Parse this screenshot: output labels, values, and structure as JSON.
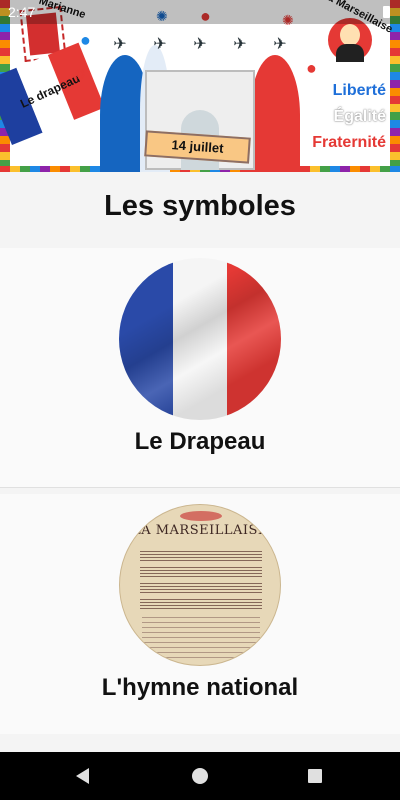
{
  "status_bar": {
    "time": "2:47"
  },
  "banner": {
    "marianne_label": "Marianne",
    "drapeau_label": "Le drapeau",
    "date_label": "14 juillet",
    "anthem_label": "La Marseillaise",
    "motto": {
      "liberte": "Liberté",
      "egalite": "Égalité",
      "fraternite": "Fraternité"
    },
    "colors": {
      "blue": "#1e3f9f",
      "white": "#ffffff",
      "red": "#e53935"
    }
  },
  "page": {
    "title": "Les symboles"
  },
  "cards": [
    {
      "label": "Le Drapeau",
      "image": "french-flag"
    },
    {
      "label": "L'hymne national",
      "image": "marseillaise-score",
      "score_title": "LA MARSEILLAISE"
    }
  ],
  "nav": {
    "back": "back-icon",
    "home": "home-icon",
    "recent": "recent-apps-icon"
  }
}
